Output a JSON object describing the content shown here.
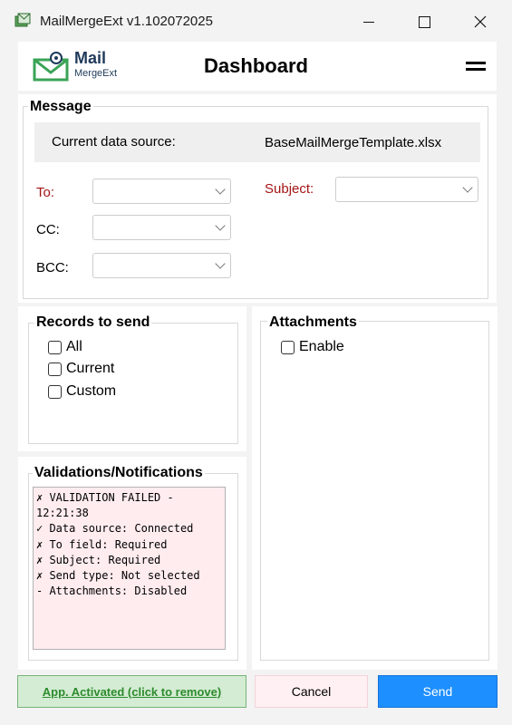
{
  "window": {
    "title": "MailMergeExt v1.102072025",
    "icon": "mailmerge-app-icon",
    "controls": [
      "minimize-icon",
      "maximize-icon",
      "close-icon"
    ]
  },
  "header": {
    "logo_main": "Mail",
    "logo_sub": "MergeExt",
    "title": "Dashboard",
    "menu_icon": "hamburger-menu-icon"
  },
  "message": {
    "group_label": "Message",
    "data_source_label": "Current data source:",
    "data_source_value": "BaseMailMergeTemplate.xlsx",
    "to_label": "To:",
    "cc_label": "CC:",
    "bcc_label": "BCC:",
    "subject_label": "Subject:",
    "to_value": "",
    "cc_value": "",
    "bcc_value": "",
    "subject_value": "",
    "required_color": "#a31515"
  },
  "records": {
    "group_label": "Records to send",
    "options": [
      {
        "label": "All",
        "checked": false
      },
      {
        "label": "Current",
        "checked": false
      },
      {
        "label": "Custom",
        "checked": false
      }
    ]
  },
  "attachments": {
    "group_label": "Attachments",
    "enable_label": "Enable",
    "enable_checked": false
  },
  "validations": {
    "group_label": "Validations/Notifications",
    "lines": [
      "✗ VALIDATION FAILED -",
      "12:21:38",
      "✓ Data source: Connected",
      "✗ To field: Required",
      "✗ Subject: Required",
      "✗ Send type: Not selected",
      "- Attachments: Disabled"
    ],
    "background": "#ffecef"
  },
  "footer": {
    "activated_label": "App. Activated (click to remove)",
    "cancel_label": "Cancel",
    "send_label": "Send",
    "send_color": "#1e8fff",
    "activated_color": "#2e8b2e"
  }
}
